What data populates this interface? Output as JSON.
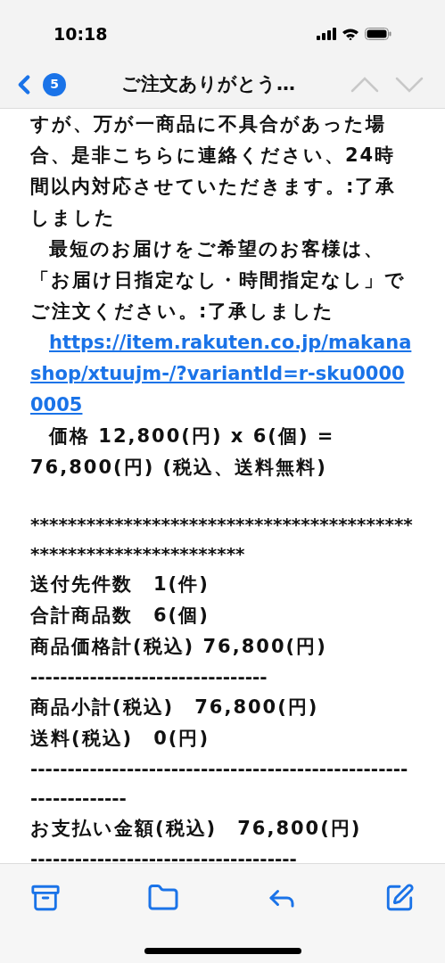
{
  "status_bar": {
    "time": "10:18"
  },
  "nav": {
    "unread_count": "5",
    "title": "ご注文ありがとう…",
    "prev_disabled": true,
    "next_disabled": true
  },
  "body": [
    {
      "kind": "text",
      "indent": false,
      "text": "すが、万が一商品に不具合があった場合、是非こちらに連絡ください、24時間以内対応させていただきます。:了承しました"
    },
    {
      "kind": "text",
      "indent": true,
      "text": "最短のお届けをご希望のお客様は、「お届け日指定なし・時間指定なし」でご注文ください。:了承しました"
    },
    {
      "kind": "link",
      "indent": true,
      "text": "https://item.rakuten.co.jp/makanashop/xtuujm-/?variantId=r-sku00000005"
    },
    {
      "kind": "text",
      "indent": true,
      "text": "価格 12,800(円) x 6(個) = 76,800(円) (税込、送料無料)"
    },
    {
      "kind": "blank"
    },
    {
      "kind": "rule",
      "text": "****************************************************************"
    },
    {
      "kind": "text",
      "indent": false,
      "text": "送付先件数　1(件)"
    },
    {
      "kind": "text",
      "indent": false,
      "text": "合計商品数　6(個)"
    },
    {
      "kind": "text",
      "indent": false,
      "text": "商品価格計(税込) 76,800(円)"
    },
    {
      "kind": "rule",
      "text": "--------------------------------"
    },
    {
      "kind": "text",
      "indent": false,
      "text": "商品小計(税込)　76,800(円)"
    },
    {
      "kind": "text",
      "indent": false,
      "text": "送料(税込)　0(円)"
    },
    {
      "kind": "rule",
      "text": "----------------------------------------------------------------"
    },
    {
      "kind": "text",
      "indent": false,
      "text": "お支払い金額(税込)　76,800(円)"
    },
    {
      "kind": "rule",
      "text": "------------------------------------"
    }
  ]
}
